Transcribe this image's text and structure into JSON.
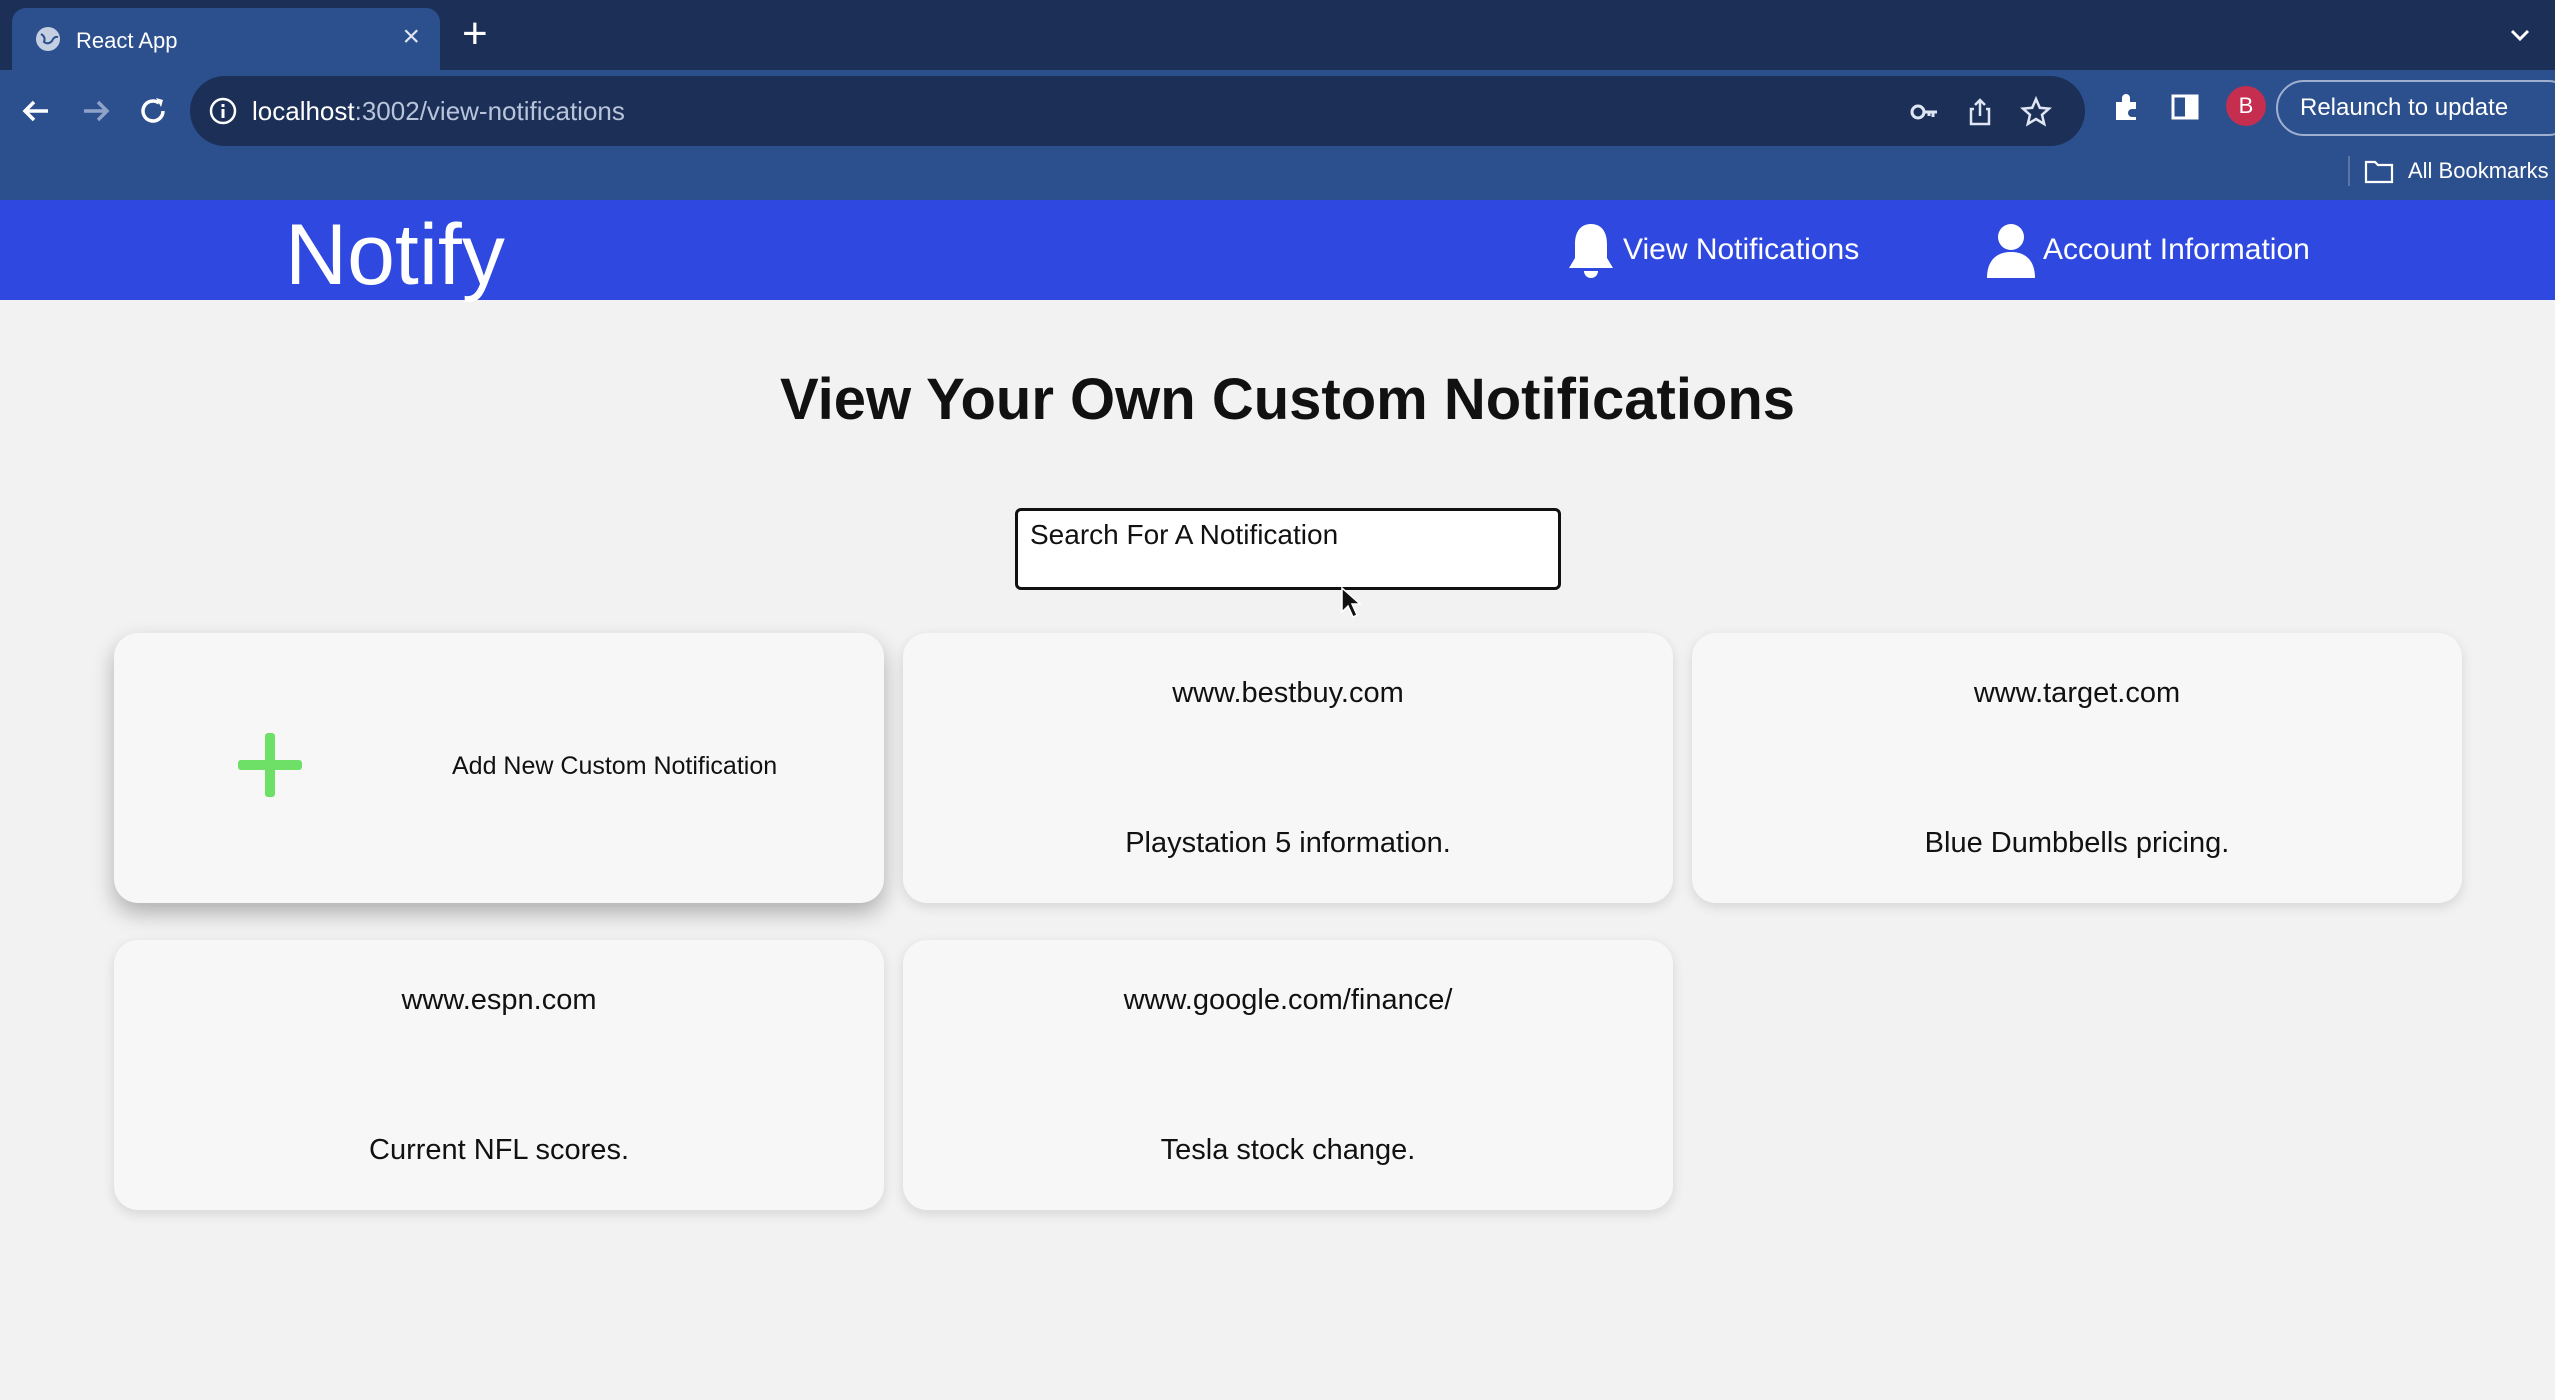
{
  "browser": {
    "tab_title": "React App",
    "url_host": "localhost",
    "url_path": ":3002/view-notifications",
    "profile_initial": "B",
    "relaunch_label": "Relaunch to update",
    "bookmarks_label": "All Bookmarks"
  },
  "app": {
    "logo": "Notify",
    "nav": {
      "view_notifications": "View Notifications",
      "account_information": "Account Information"
    }
  },
  "main": {
    "title": "View Your Own Custom Notifications",
    "search_placeholder": "Search For A Notification",
    "add_card_label": "Add New Custom Notification",
    "cards": [
      {
        "site": "www.bestbuy.com",
        "description": "Playstation 5 information."
      },
      {
        "site": "www.target.com",
        "description": "Blue Dumbbells pricing."
      },
      {
        "site": "www.espn.com",
        "description": "Current NFL scores."
      },
      {
        "site": "www.google.com/finance/",
        "description": "Tesla stock change."
      }
    ]
  },
  "colors": {
    "browser_tabbar": "#1b2f57",
    "browser_toolbar": "#2c4f8e",
    "appbar": "#2f49e0",
    "plus_icon": "#6ee067",
    "profile": "#c62e4f"
  }
}
